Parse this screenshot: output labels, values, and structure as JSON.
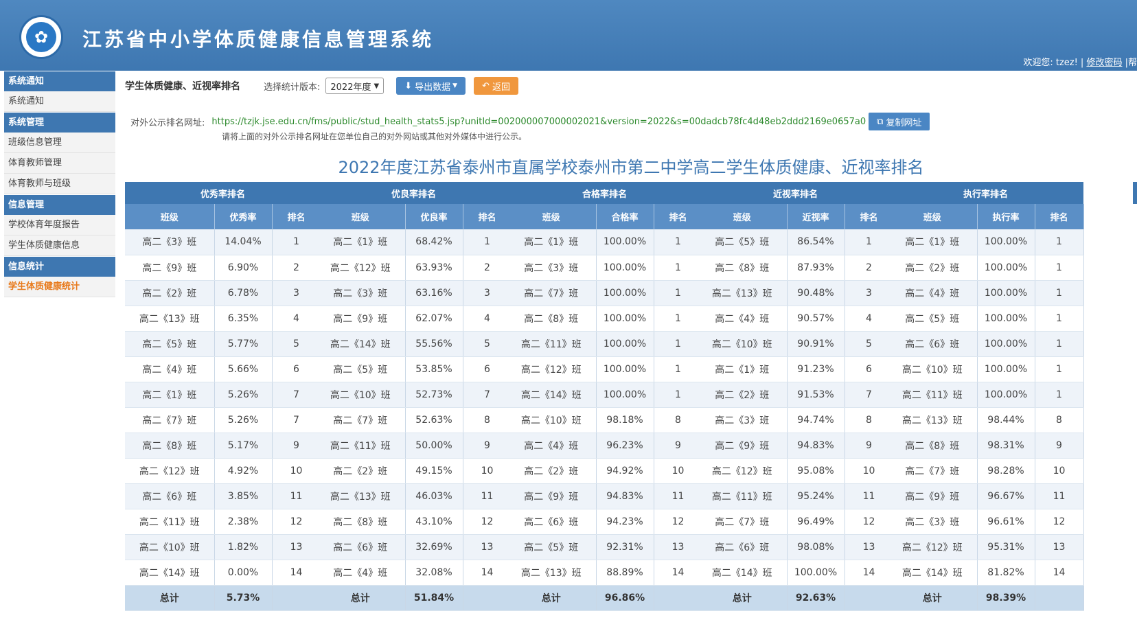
{
  "header": {
    "logo_glyph": "✿",
    "title": "江苏省中小学体质健康信息管理系统",
    "welcome": "欢迎您: tzez! |",
    "change_password": "修改密码",
    "help": "|帮"
  },
  "sidebar": {
    "sections": [
      {
        "title": "系统通知",
        "items": [
          "系统通知"
        ]
      },
      {
        "title": "系统管理",
        "items": [
          "班级信息管理",
          "体育教师管理",
          "体育教师与班级"
        ]
      },
      {
        "title": "信息管理",
        "items": [
          "学校体育年度报告",
          "学生体质健康信息"
        ]
      },
      {
        "title": "信息统计",
        "items": [
          "学生体质健康统计"
        ]
      }
    ],
    "active_item": "学生体质健康统计"
  },
  "toolbar": {
    "title": "学生体质健康、近视率排名",
    "version_label": "选择统计版本:",
    "version_value": "2022年度",
    "export_label": "导出数据",
    "back_label": "返回"
  },
  "public_url": {
    "label": "对外公示排名网址:",
    "url": "https://tzjk.jse.edu.cn/fms/public/stud_health_stats5.jsp?unitId=002000007000002021&version=2022&s=00dadcb78fc4d48eb2ddd2169e0657a0",
    "copy_label": "复制网址",
    "hint": "请将上面的对外公示排名网址在您单位自己的对外网站或其他对外媒体中进行公示。"
  },
  "report_title": "2022年度江苏省泰州市直属学校泰州市第二中学高二学生体质健康、近视率排名",
  "total_label": "总计",
  "tables": [
    {
      "title": "优秀率排名",
      "columns": [
        "班级",
        "优秀率",
        "排名"
      ],
      "rows": [
        [
          "高二《3》班",
          "14.04%",
          "1"
        ],
        [
          "高二《9》班",
          "6.90%",
          "2"
        ],
        [
          "高二《2》班",
          "6.78%",
          "3"
        ],
        [
          "高二《13》班",
          "6.35%",
          "4"
        ],
        [
          "高二《5》班",
          "5.77%",
          "5"
        ],
        [
          "高二《4》班",
          "5.66%",
          "6"
        ],
        [
          "高二《1》班",
          "5.26%",
          "7"
        ],
        [
          "高二《7》班",
          "5.26%",
          "7"
        ],
        [
          "高二《8》班",
          "5.17%",
          "9"
        ],
        [
          "高二《12》班",
          "4.92%",
          "10"
        ],
        [
          "高二《6》班",
          "3.85%",
          "11"
        ],
        [
          "高二《11》班",
          "2.38%",
          "12"
        ],
        [
          "高二《10》班",
          "1.82%",
          "13"
        ],
        [
          "高二《14》班",
          "0.00%",
          "14"
        ]
      ],
      "total": "5.73%"
    },
    {
      "title": "优良率排名",
      "columns": [
        "班级",
        "优良率",
        "排名"
      ],
      "rows": [
        [
          "高二《1》班",
          "68.42%",
          "1"
        ],
        [
          "高二《12》班",
          "63.93%",
          "2"
        ],
        [
          "高二《3》班",
          "63.16%",
          "3"
        ],
        [
          "高二《9》班",
          "62.07%",
          "4"
        ],
        [
          "高二《14》班",
          "55.56%",
          "5"
        ],
        [
          "高二《5》班",
          "53.85%",
          "6"
        ],
        [
          "高二《10》班",
          "52.73%",
          "7"
        ],
        [
          "高二《7》班",
          "52.63%",
          "8"
        ],
        [
          "高二《11》班",
          "50.00%",
          "9"
        ],
        [
          "高二《2》班",
          "49.15%",
          "10"
        ],
        [
          "高二《13》班",
          "46.03%",
          "11"
        ],
        [
          "高二《8》班",
          "43.10%",
          "12"
        ],
        [
          "高二《6》班",
          "32.69%",
          "13"
        ],
        [
          "高二《4》班",
          "32.08%",
          "14"
        ]
      ],
      "total": "51.84%"
    },
    {
      "title": "合格率排名",
      "columns": [
        "班级",
        "合格率",
        "排名"
      ],
      "rows": [
        [
          "高二《1》班",
          "100.00%",
          "1"
        ],
        [
          "高二《3》班",
          "100.00%",
          "1"
        ],
        [
          "高二《7》班",
          "100.00%",
          "1"
        ],
        [
          "高二《8》班",
          "100.00%",
          "1"
        ],
        [
          "高二《11》班",
          "100.00%",
          "1"
        ],
        [
          "高二《12》班",
          "100.00%",
          "1"
        ],
        [
          "高二《14》班",
          "100.00%",
          "1"
        ],
        [
          "高二《10》班",
          "98.18%",
          "8"
        ],
        [
          "高二《4》班",
          "96.23%",
          "9"
        ],
        [
          "高二《2》班",
          "94.92%",
          "10"
        ],
        [
          "高二《9》班",
          "94.83%",
          "11"
        ],
        [
          "高二《6》班",
          "94.23%",
          "12"
        ],
        [
          "高二《5》班",
          "92.31%",
          "13"
        ],
        [
          "高二《13》班",
          "88.89%",
          "14"
        ]
      ],
      "total": "96.86%"
    },
    {
      "title": "近视率排名",
      "columns": [
        "班级",
        "近视率",
        "排名"
      ],
      "rows": [
        [
          "高二《5》班",
          "86.54%",
          "1"
        ],
        [
          "高二《8》班",
          "87.93%",
          "2"
        ],
        [
          "高二《13》班",
          "90.48%",
          "3"
        ],
        [
          "高二《4》班",
          "90.57%",
          "4"
        ],
        [
          "高二《10》班",
          "90.91%",
          "5"
        ],
        [
          "高二《1》班",
          "91.23%",
          "6"
        ],
        [
          "高二《2》班",
          "91.53%",
          "7"
        ],
        [
          "高二《3》班",
          "94.74%",
          "8"
        ],
        [
          "高二《9》班",
          "94.83%",
          "9"
        ],
        [
          "高二《12》班",
          "95.08%",
          "10"
        ],
        [
          "高二《11》班",
          "95.24%",
          "11"
        ],
        [
          "高二《7》班",
          "96.49%",
          "12"
        ],
        [
          "高二《6》班",
          "98.08%",
          "13"
        ],
        [
          "高二《14》班",
          "100.00%",
          "14"
        ]
      ],
      "total": "92.63%"
    },
    {
      "title": "执行率排名",
      "columns": [
        "班级",
        "执行率",
        "排名"
      ],
      "rows": [
        [
          "高二《1》班",
          "100.00%",
          "1"
        ],
        [
          "高二《2》班",
          "100.00%",
          "1"
        ],
        [
          "高二《4》班",
          "100.00%",
          "1"
        ],
        [
          "高二《5》班",
          "100.00%",
          "1"
        ],
        [
          "高二《6》班",
          "100.00%",
          "1"
        ],
        [
          "高二《10》班",
          "100.00%",
          "1"
        ],
        [
          "高二《11》班",
          "100.00%",
          "1"
        ],
        [
          "高二《13》班",
          "98.44%",
          "8"
        ],
        [
          "高二《8》班",
          "98.31%",
          "9"
        ],
        [
          "高二《7》班",
          "98.28%",
          "10"
        ],
        [
          "高二《9》班",
          "96.67%",
          "11"
        ],
        [
          "高二《3》班",
          "96.61%",
          "12"
        ],
        [
          "高二《12》班",
          "95.31%",
          "13"
        ],
        [
          "高二《14》班",
          "81.82%",
          "14"
        ]
      ],
      "total": "98.39%"
    }
  ]
}
